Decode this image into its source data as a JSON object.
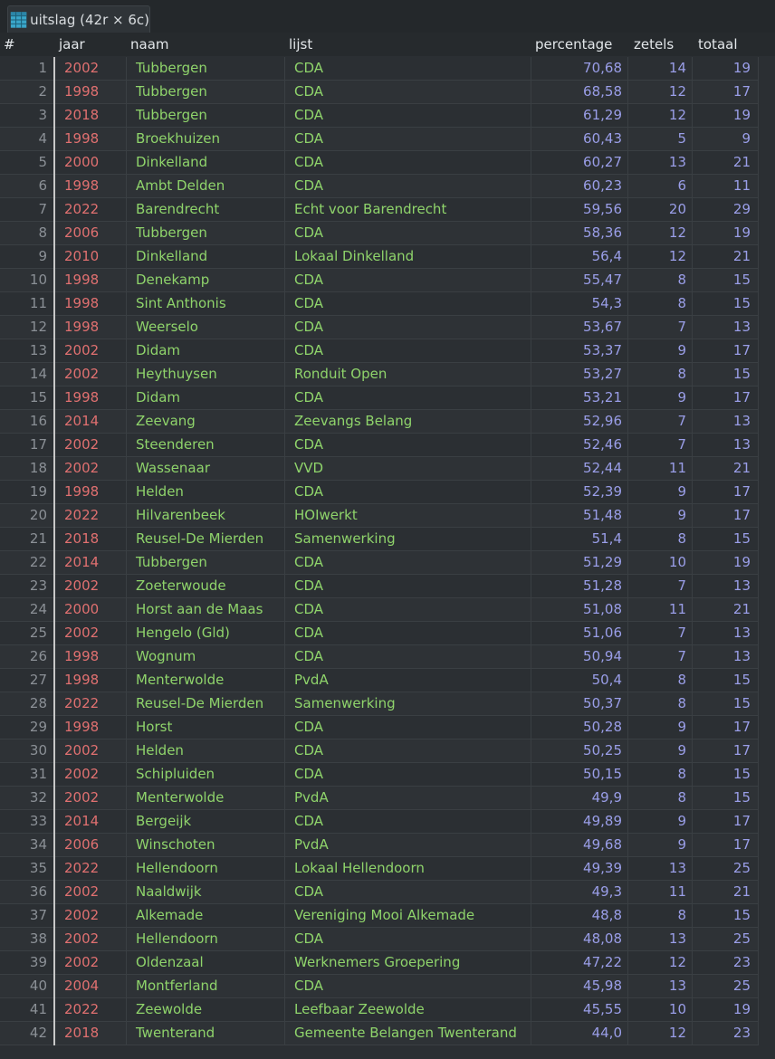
{
  "tab": {
    "icon": "table-grid-icon",
    "label": "uitslag (42r × 6c)"
  },
  "columns": {
    "idx": "#",
    "jaar": "jaar",
    "naam": "naam",
    "lijst": "lijst",
    "percentage": "percentage",
    "zetels": "zetels",
    "totaal": "totaal"
  },
  "colors": {
    "background": "#2b2f33",
    "jaar": "#e07070",
    "text": "#8fd46b",
    "number": "#9a9ee8",
    "index": "#8b9096"
  },
  "rows": [
    [
      "1",
      "2002",
      "Tubbergen",
      "CDA",
      "70,68",
      "14",
      "19"
    ],
    [
      "2",
      "1998",
      "Tubbergen",
      "CDA",
      "68,58",
      "12",
      "17"
    ],
    [
      "3",
      "2018",
      "Tubbergen",
      "CDA",
      "61,29",
      "12",
      "19"
    ],
    [
      "4",
      "1998",
      "Broekhuizen",
      "CDA",
      "60,43",
      "5",
      "9"
    ],
    [
      "5",
      "2000",
      "Dinkelland",
      "CDA",
      "60,27",
      "13",
      "21"
    ],
    [
      "6",
      "1998",
      "Ambt Delden",
      "CDA",
      "60,23",
      "6",
      "11"
    ],
    [
      "7",
      "2022",
      "Barendrecht",
      "Echt voor Barendrecht",
      "59,56",
      "20",
      "29"
    ],
    [
      "8",
      "2006",
      "Tubbergen",
      "CDA",
      "58,36",
      "12",
      "19"
    ],
    [
      "9",
      "2010",
      "Dinkelland",
      "Lokaal Dinkelland",
      "56,4",
      "12",
      "21"
    ],
    [
      "10",
      "1998",
      "Denekamp",
      "CDA",
      "55,47",
      "8",
      "15"
    ],
    [
      "11",
      "1998",
      "Sint Anthonis",
      "CDA",
      "54,3",
      "8",
      "15"
    ],
    [
      "12",
      "1998",
      "Weerselo",
      "CDA",
      "53,67",
      "7",
      "13"
    ],
    [
      "13",
      "2002",
      "Didam",
      "CDA",
      "53,37",
      "9",
      "17"
    ],
    [
      "14",
      "2002",
      "Heythuysen",
      "Ronduit Open",
      "53,27",
      "8",
      "15"
    ],
    [
      "15",
      "1998",
      "Didam",
      "CDA",
      "53,21",
      "9",
      "17"
    ],
    [
      "16",
      "2014",
      "Zeevang",
      "Zeevangs Belang",
      "52,96",
      "7",
      "13"
    ],
    [
      "17",
      "2002",
      "Steenderen",
      "CDA",
      "52,46",
      "7",
      "13"
    ],
    [
      "18",
      "2002",
      "Wassenaar",
      "VVD",
      "52,44",
      "11",
      "21"
    ],
    [
      "19",
      "1998",
      "Helden",
      "CDA",
      "52,39",
      "9",
      "17"
    ],
    [
      "20",
      "2022",
      "Hilvarenbeek",
      "HOIwerkt",
      "51,48",
      "9",
      "17"
    ],
    [
      "21",
      "2018",
      "Reusel-De Mierden",
      "Samenwerking",
      "51,4",
      "8",
      "15"
    ],
    [
      "22",
      "2014",
      "Tubbergen",
      "CDA",
      "51,29",
      "10",
      "19"
    ],
    [
      "23",
      "2002",
      "Zoeterwoude",
      "CDA",
      "51,28",
      "7",
      "13"
    ],
    [
      "24",
      "2000",
      "Horst aan de Maas",
      "CDA",
      "51,08",
      "11",
      "21"
    ],
    [
      "25",
      "2002",
      "Hengelo (Gld)",
      "CDA",
      "51,06",
      "7",
      "13"
    ],
    [
      "26",
      "1998",
      "Wognum",
      "CDA",
      "50,94",
      "7",
      "13"
    ],
    [
      "27",
      "1998",
      "Menterwolde",
      "PvdA",
      "50,4",
      "8",
      "15"
    ],
    [
      "28",
      "2022",
      "Reusel-De Mierden",
      "Samenwerking",
      "50,37",
      "8",
      "15"
    ],
    [
      "29",
      "1998",
      "Horst",
      "CDA",
      "50,28",
      "9",
      "17"
    ],
    [
      "30",
      "2002",
      "Helden",
      "CDA",
      "50,25",
      "9",
      "17"
    ],
    [
      "31",
      "2002",
      "Schipluiden",
      "CDA",
      "50,15",
      "8",
      "15"
    ],
    [
      "32",
      "2002",
      "Menterwolde",
      "PvdA",
      "49,9",
      "8",
      "15"
    ],
    [
      "33",
      "2014",
      "Bergeijk",
      "CDA",
      "49,89",
      "9",
      "17"
    ],
    [
      "34",
      "2006",
      "Winschoten",
      "PvdA",
      "49,68",
      "9",
      "17"
    ],
    [
      "35",
      "2022",
      "Hellendoorn",
      "Lokaal Hellendoorn",
      "49,39",
      "13",
      "25"
    ],
    [
      "36",
      "2002",
      "Naaldwijk",
      "CDA",
      "49,3",
      "11",
      "21"
    ],
    [
      "37",
      "2002",
      "Alkemade",
      "Vereniging Mooi Alkemade",
      "48,8",
      "8",
      "15"
    ],
    [
      "38",
      "2002",
      "Hellendoorn",
      "CDA",
      "48,08",
      "13",
      "25"
    ],
    [
      "39",
      "2002",
      "Oldenzaal",
      "Werknemers Groepering",
      "47,22",
      "12",
      "23"
    ],
    [
      "40",
      "2004",
      "Montferland",
      "CDA",
      "45,98",
      "13",
      "25"
    ],
    [
      "41",
      "2022",
      "Zeewolde",
      "Leefbaar Zeewolde",
      "45,55",
      "10",
      "19"
    ],
    [
      "42",
      "2018",
      "Twenterand",
      "Gemeente Belangen Twenterand",
      "44,0",
      "12",
      "23"
    ]
  ]
}
